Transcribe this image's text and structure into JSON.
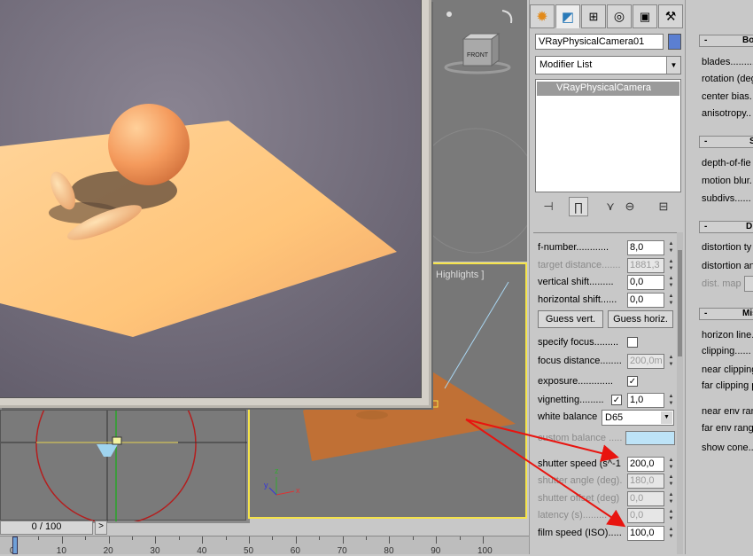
{
  "render_window": {},
  "viewports": {
    "persp_label": "Highlights ]",
    "viewcube_label": "FRONT",
    "axis_x": "x",
    "axis_y": "y",
    "axis_z": "z"
  },
  "command_panel": {
    "tabs": [
      "create-icon",
      "modify-icon",
      "hierarchy-icon",
      "motion-icon",
      "display-icon",
      "utilities-icon"
    ],
    "object_name": "VRayPhysicalCamera01",
    "object_color": "#5b7fd1",
    "modifier_list": "Modifier List",
    "stack_item": "VRayPhysicalCamera",
    "params": {
      "f_number": {
        "label": "f-number............",
        "value": "8,0"
      },
      "target_distance": {
        "label": "target distance.......",
        "value": "1881,3"
      },
      "vertical_shift": {
        "label": "vertical shift.........",
        "value": "0,0"
      },
      "horizontal_shift": {
        "label": "horizontal shift......",
        "value": "0,0"
      },
      "guess_vert": "Guess vert.",
      "guess_horiz": "Guess horiz.",
      "specify_focus": {
        "label": "specify focus.........",
        "checked": ""
      },
      "focus_distance": {
        "label": "focus distance........",
        "value": "200,0m"
      },
      "exposure": {
        "label": "exposure.............",
        "checked": "✓"
      },
      "vignetting": {
        "label": "vignetting.........",
        "checked": "✓",
        "value": "1,0"
      },
      "white_balance": {
        "label": "white balance",
        "value": "D65"
      },
      "custom_balance": {
        "label": "custom balance .....",
        "color": "#bde3f7"
      },
      "shutter_speed": {
        "label": "shutter speed (s^-1",
        "value": "200,0"
      },
      "shutter_angle": {
        "label": "shutter angle (deg).",
        "value": "180,0"
      },
      "shutter_offset": {
        "label": "shutter offset (deg)",
        "value": "0,0"
      },
      "latency": {
        "label": "latency (s).........",
        "value": "0,0"
      },
      "film_speed": {
        "label": "film speed (ISO).....",
        "value": "100,0"
      }
    }
  },
  "right_panel": {
    "rollouts": [
      {
        "title": "Bok",
        "items": [
          "blades.........",
          "rotation (deg",
          "center bias.",
          "anisotropy.."
        ]
      },
      {
        "title": "S",
        "items": [
          "depth-of-fie",
          "motion blur.",
          "subdivs......"
        ]
      },
      {
        "title": "D",
        "items": [
          "distortion ty",
          "distortion an",
          "dist. map"
        ]
      },
      {
        "title": "Mis",
        "items": [
          "horizon line.",
          "clipping......",
          "near clipping",
          "far clipping p",
          "near env ran",
          "far env rang",
          "show cone.."
        ]
      }
    ]
  },
  "timeline": {
    "slider_text": "0 / 100",
    "next_label": ">",
    "ticks": [
      "0",
      "10",
      "20",
      "30",
      "40",
      "50",
      "60",
      "70",
      "80",
      "90",
      "100"
    ]
  }
}
